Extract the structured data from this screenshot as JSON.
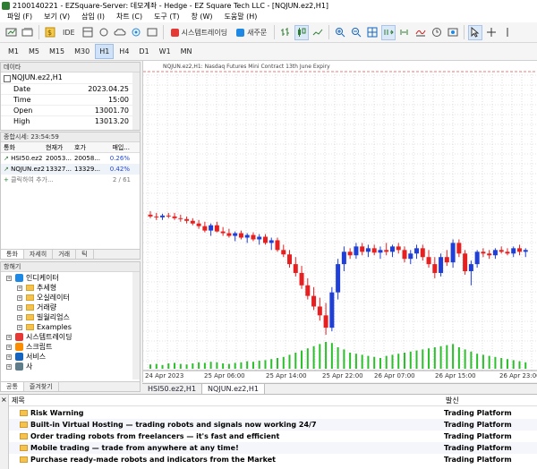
{
  "window": {
    "title": "2100140221 - EZSquare-Server: 데모계좌 - Hedge - EZ Square Tech LLC - [NQJUN.ez2,H1]"
  },
  "menu": [
    "파일 (F)",
    "보기 (V)",
    "삽입 (I)",
    "차트 (C)",
    "도구 (T)",
    "창 (W)",
    "도움말 (H)"
  ],
  "toolbar": {
    "ide_label": "IDE",
    "autotrading_label": "시스템트레이딩",
    "neworder_label": "새주문"
  },
  "timeframes": {
    "items": [
      "M1",
      "M5",
      "M15",
      "M30",
      "H1",
      "H4",
      "D1",
      "W1",
      "MN"
    ],
    "active": "H1"
  },
  "data_window": {
    "title": "데이타",
    "symbol": "NQJUN.ez2,H1",
    "rows": [
      {
        "k": "Date",
        "v": "2023.04.25"
      },
      {
        "k": "Time",
        "v": "15:00"
      },
      {
        "k": "Open",
        "v": "13001.70"
      },
      {
        "k": "High",
        "v": "13013.20"
      }
    ]
  },
  "market_watch": {
    "title": "종합시세: 23:54:59",
    "headers": [
      "통화",
      "현재가",
      "호가",
      "매입..."
    ],
    "rows": [
      {
        "sym": "HSI50.ez2",
        "bid": "20053...",
        "ask": "20058...",
        "chg": "0.26%"
      },
      {
        "sym": "NQJUN.ez2",
        "bid": "13327...",
        "ask": "13329...",
        "chg": "0.42%"
      }
    ],
    "add_label": "클릭하여 추가...",
    "count": "2 / 61",
    "tabs": [
      "통화",
      "자세히",
      "거래",
      "틱"
    ]
  },
  "navigator": {
    "title": "항해기",
    "items": [
      {
        "label": "인디케이터",
        "level": 0,
        "type": "group"
      },
      {
        "label": "추세형",
        "level": 1,
        "type": "folder"
      },
      {
        "label": "오실레이터",
        "level": 1,
        "type": "folder"
      },
      {
        "label": "거래량",
        "level": 1,
        "type": "folder"
      },
      {
        "label": "빌월리엄스",
        "level": 1,
        "type": "folder"
      },
      {
        "label": "Examples",
        "level": 1,
        "type": "folder"
      },
      {
        "label": "시스템트레이딩",
        "level": 0,
        "type": "group"
      },
      {
        "label": "스크립트",
        "level": 0,
        "type": "group"
      },
      {
        "label": "서비스",
        "level": 0,
        "type": "group"
      },
      {
        "label": "사",
        "level": 0,
        "type": "group"
      }
    ],
    "tabs": [
      "공통",
      "즐겨찾기"
    ]
  },
  "chart": {
    "title_text": "NQJUN.ez2,H1:  Nasdaq Futures Mini Contract 13th June Expiry",
    "tabs": [
      "HSI50.ez2,H1",
      "NQJUN.ez2,H1"
    ],
    "active_tab": "NQJUN.ez2,H1",
    "colors": {
      "up": "#1f3fd6",
      "down": "#e62020",
      "volume": "#2bbf2b",
      "grid": "#c9c9c9"
    }
  },
  "chart_data": {
    "type": "candlestick",
    "x_labels": [
      "24 Apr 2023",
      "25 Apr 06:00",
      "25 Apr 14:00",
      "25 Apr 22:00",
      "26 Apr 07:00",
      "26 Apr 15:00",
      "26 Apr 23:00"
    ],
    "candles": [
      {
        "o": 13500,
        "h": 13520,
        "l": 13480,
        "c": 13490
      },
      {
        "o": 13490,
        "h": 13510,
        "l": 13470,
        "c": 13485
      },
      {
        "o": 13485,
        "h": 13505,
        "l": 13470,
        "c": 13495
      },
      {
        "o": 13495,
        "h": 13510,
        "l": 13480,
        "c": 13490
      },
      {
        "o": 13490,
        "h": 13510,
        "l": 13470,
        "c": 13480
      },
      {
        "o": 13480,
        "h": 13500,
        "l": 13460,
        "c": 13475
      },
      {
        "o": 13475,
        "h": 13490,
        "l": 13450,
        "c": 13465
      },
      {
        "o": 13465,
        "h": 13480,
        "l": 13440,
        "c": 13450
      },
      {
        "o": 13450,
        "h": 13470,
        "l": 13420,
        "c": 13435
      },
      {
        "o": 13435,
        "h": 13460,
        "l": 13400,
        "c": 13410
      },
      {
        "o": 13410,
        "h": 13450,
        "l": 13380,
        "c": 13440
      },
      {
        "o": 13440,
        "h": 13460,
        "l": 13400,
        "c": 13405
      },
      {
        "o": 13405,
        "h": 13430,
        "l": 13380,
        "c": 13395
      },
      {
        "o": 13395,
        "h": 13420,
        "l": 13370,
        "c": 13380
      },
      {
        "o": 13380,
        "h": 13405,
        "l": 13350,
        "c": 13395
      },
      {
        "o": 13395,
        "h": 13410,
        "l": 13360,
        "c": 13370
      },
      {
        "o": 13370,
        "h": 13395,
        "l": 13340,
        "c": 13385
      },
      {
        "o": 13385,
        "h": 13400,
        "l": 13350,
        "c": 13360
      },
      {
        "o": 13360,
        "h": 13390,
        "l": 13330,
        "c": 13375
      },
      {
        "o": 13375,
        "h": 13390,
        "l": 13330,
        "c": 13340
      },
      {
        "o": 13340,
        "h": 13370,
        "l": 13300,
        "c": 13355
      },
      {
        "o": 13355,
        "h": 13370,
        "l": 13290,
        "c": 13300
      },
      {
        "o": 13300,
        "h": 13330,
        "l": 13260,
        "c": 13275
      },
      {
        "o": 13275,
        "h": 13300,
        "l": 13200,
        "c": 13220
      },
      {
        "o": 13220,
        "h": 13260,
        "l": 13150,
        "c": 13170
      },
      {
        "o": 13170,
        "h": 13210,
        "l": 13080,
        "c": 13100
      },
      {
        "o": 13100,
        "h": 13140,
        "l": 13020,
        "c": 13040
      },
      {
        "o": 13040,
        "h": 13090,
        "l": 12960,
        "c": 12980
      },
      {
        "o": 12980,
        "h": 13030,
        "l": 12900,
        "c": 12930
      },
      {
        "o": 12930,
        "h": 13000,
        "l": 12820,
        "c": 12860
      },
      {
        "o": 12860,
        "h": 13090,
        "l": 12840,
        "c": 13060
      },
      {
        "o": 13060,
        "h": 13250,
        "l": 13020,
        "c": 13220
      },
      {
        "o": 13220,
        "h": 13320,
        "l": 13180,
        "c": 13290
      },
      {
        "o": 13290,
        "h": 13310,
        "l": 13250,
        "c": 13270
      },
      {
        "o": 13270,
        "h": 13340,
        "l": 13250,
        "c": 13320
      },
      {
        "o": 13320,
        "h": 13340,
        "l": 13270,
        "c": 13290
      },
      {
        "o": 13290,
        "h": 13330,
        "l": 13260,
        "c": 13310
      },
      {
        "o": 13310,
        "h": 13330,
        "l": 13270,
        "c": 13285
      },
      {
        "o": 13285,
        "h": 13320,
        "l": 13250,
        "c": 13300
      },
      {
        "o": 13300,
        "h": 13340,
        "l": 13270,
        "c": 13290
      },
      {
        "o": 13290,
        "h": 13330,
        "l": 13260,
        "c": 13320
      },
      {
        "o": 13320,
        "h": 13340,
        "l": 13280,
        "c": 13300
      },
      {
        "o": 13300,
        "h": 13320,
        "l": 13230,
        "c": 13250
      },
      {
        "o": 13250,
        "h": 13300,
        "l": 13220,
        "c": 13280
      },
      {
        "o": 13280,
        "h": 13330,
        "l": 13250,
        "c": 13310
      },
      {
        "o": 13310,
        "h": 13330,
        "l": 13240,
        "c": 13260
      },
      {
        "o": 13260,
        "h": 13300,
        "l": 13200,
        "c": 13220
      },
      {
        "o": 13220,
        "h": 13260,
        "l": 13140,
        "c": 13170
      },
      {
        "o": 13170,
        "h": 13280,
        "l": 13150,
        "c": 13260
      },
      {
        "o": 13260,
        "h": 13300,
        "l": 13210,
        "c": 13230
      },
      {
        "o": 13230,
        "h": 13360,
        "l": 13200,
        "c": 13340
      },
      {
        "o": 13340,
        "h": 13360,
        "l": 13260,
        "c": 13280
      },
      {
        "o": 13280,
        "h": 13300,
        "l": 13160,
        "c": 13180
      },
      {
        "o": 13180,
        "h": 13240,
        "l": 13100,
        "c": 13220
      },
      {
        "o": 13220,
        "h": 13300,
        "l": 13200,
        "c": 13290
      },
      {
        "o": 13290,
        "h": 13310,
        "l": 13260,
        "c": 13280
      },
      {
        "o": 13280,
        "h": 13300,
        "l": 13250,
        "c": 13270
      },
      {
        "o": 13270,
        "h": 13310,
        "l": 13250,
        "c": 13300
      },
      {
        "o": 13300,
        "h": 13320,
        "l": 13280,
        "c": 13290
      },
      {
        "o": 13290,
        "h": 13310,
        "l": 13270,
        "c": 13280
      },
      {
        "o": 13280,
        "h": 13320,
        "l": 13260,
        "c": 13310
      },
      {
        "o": 13310,
        "h": 13330,
        "l": 13270,
        "c": 13290
      },
      {
        "o": 13290,
        "h": 13310,
        "l": 13260,
        "c": 13300
      }
    ],
    "volumes": [
      8,
      9,
      7,
      10,
      11,
      9,
      8,
      10,
      12,
      11,
      13,
      12,
      10,
      9,
      11,
      12,
      14,
      13,
      15,
      16,
      18,
      20,
      22,
      26,
      30,
      34,
      38,
      42,
      46,
      50,
      48,
      40,
      36,
      30,
      28,
      26,
      24,
      22,
      20,
      24,
      26,
      28,
      30,
      32,
      34,
      36,
      38,
      40,
      42,
      44,
      46,
      40,
      36,
      32,
      28,
      26,
      24,
      22,
      20,
      18,
      16,
      14,
      12
    ],
    "ylim": [
      12800,
      13560
    ]
  },
  "toolbox": {
    "headers": {
      "subject": "제목",
      "source": "발신"
    },
    "rows": [
      {
        "subject": "Risk Warning",
        "source": "Trading Platform"
      },
      {
        "subject": "Built-in Virtual Hosting — trading robots and signals now working 24/7",
        "source": "Trading Platform"
      },
      {
        "subject": "Order trading robots from freelancers — it's fast and efficient",
        "source": "Trading Platform"
      },
      {
        "subject": "Mobile trading — trade from anywhere at any time!",
        "source": "Trading Platform"
      },
      {
        "subject": "Purchase ready-made robots and indicators from the Market",
        "source": "Trading Platform"
      }
    ]
  }
}
